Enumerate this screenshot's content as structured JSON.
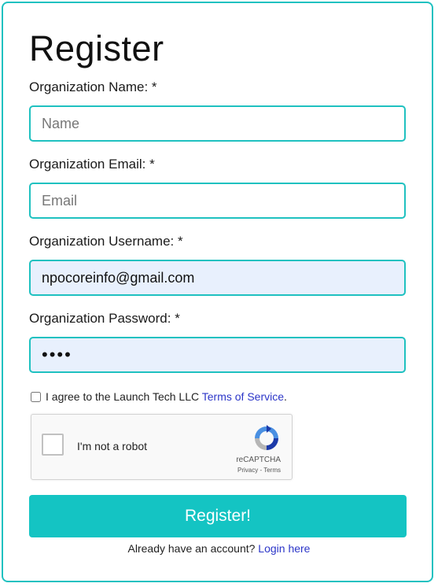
{
  "form": {
    "title": "Register",
    "name_label": "Organization Name: *",
    "name_placeholder": "Name",
    "email_label": "Organization Email: *",
    "email_placeholder": "Email",
    "username_label": "Organization Username: *",
    "username_value": "npocoreinfo@gmail.com",
    "password_label": "Organization Password: *",
    "password_value": "••••",
    "terms_prefix": "I agree to the Launch Tech LLC",
    "terms_link": "Terms of Service",
    "terms_suffix": ".",
    "submit_label": "Register!",
    "login_prompt": "Already have an account?",
    "login_link": "Login here"
  },
  "captcha": {
    "label": "I'm not a robot",
    "brand": "reCAPTCHA",
    "links": "Privacy - Terms"
  },
  "colors": {
    "accent": "#1fc1c0",
    "button": "#14c4c3",
    "link": "#2b35c8",
    "autofill": "#e8f0fd"
  }
}
